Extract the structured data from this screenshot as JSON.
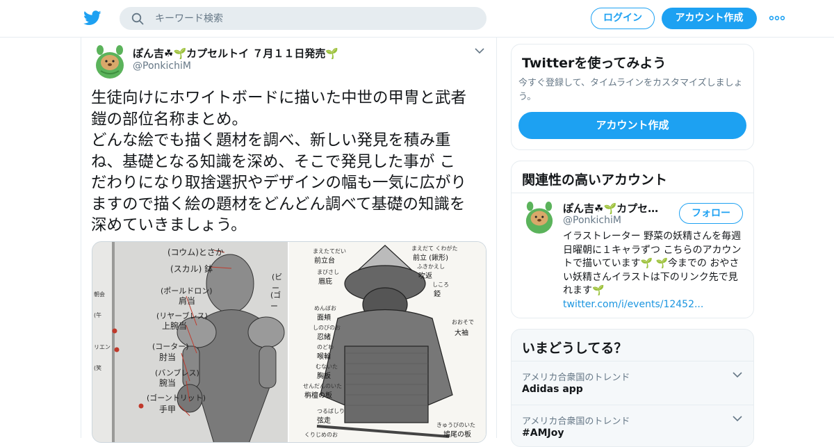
{
  "header": {
    "search_placeholder": "キーワード検索",
    "login_label": "ログイン",
    "signup_label": "アカウント作成"
  },
  "tweet": {
    "author_name": "ぽん吉☘🌱カプセルトイ ７月１１日発売🌱",
    "author_handle": "@PonkichiM",
    "text": "生徒向けにホワイトボードに描いた中世の甲冑と武者\n鎧の部位名称まとめ。\nどんな絵でも描く題材を調べ、新しい発見を積み重\nね、基礎となる知識を深め、そこで発見した事が こ\nだわりになり取捨選択やデザインの幅も一気に広がり\nますので描く絵の題材をどんどん調べて基礎の知識を\n深めていきましょう。",
    "media_left_labels": [
      "(コウム)とさか",
      "(スカル) 鉢",
      "(ポールドロン)",
      "肩当",
      "(リヤーブレス)",
      "上腕当",
      "(コーター)",
      "肘当",
      "(バンブレス)",
      "腕当",
      "(ゴーントリット)",
      "手甲",
      "(ビー",
      "(ゴー"
    ],
    "media_left_side": [
      "朝会",
      "リエン",
      "(午",
      "(笑"
    ],
    "media_right_labels": [
      "まえたてだい",
      "前立台",
      "まびさし",
      "眉庇",
      "めんぼお",
      "面頬",
      "しのびのお",
      "忍緒",
      "のどわ",
      "喉輪",
      "むないた",
      "胸板",
      "せんだんのいた",
      "栴檀の板",
      "つるばしり",
      "弦走",
      "まえだて くわがた",
      "前立 (鍬形)",
      "ふきかえし",
      "吹返",
      "しころ",
      "錏",
      "おおそで",
      "大袖",
      "きゅうびのいた",
      "鳩尾の板",
      "くりじめのお"
    ]
  },
  "sidebar": {
    "try_title": "Twitterを使ってみよう",
    "try_sub": "今すぐ登録して、タイムラインをカスタマイズしましょう。",
    "try_cta": "アカウント作成",
    "related_title": "関連性の高いアカウント",
    "related_name": "ぽん吉☘🌱カプセ…",
    "related_handle": "@PonkichiM",
    "follow_label": "フォロー",
    "related_bio": "イラストレーター 野菜の妖精さんを毎週日曜朝に１キャラずつ こちらのアカウントで描いています🌱 🌱今までの おやさい妖精さんイラストは下のリンク先で見れます🌱",
    "related_link": "twitter.com/i/events/12452...",
    "trends_title": "いまどうしてる？",
    "trends": [
      {
        "meta": "アメリカ合衆国のトレンド",
        "name": "Adidas app"
      },
      {
        "meta": "アメリカ合衆国のトレンド",
        "name": "#AMJoy"
      }
    ]
  },
  "colors": {
    "accent": "#1da1f2",
    "text": "#14171a",
    "muted": "#657786",
    "border": "#e6ecf0"
  }
}
